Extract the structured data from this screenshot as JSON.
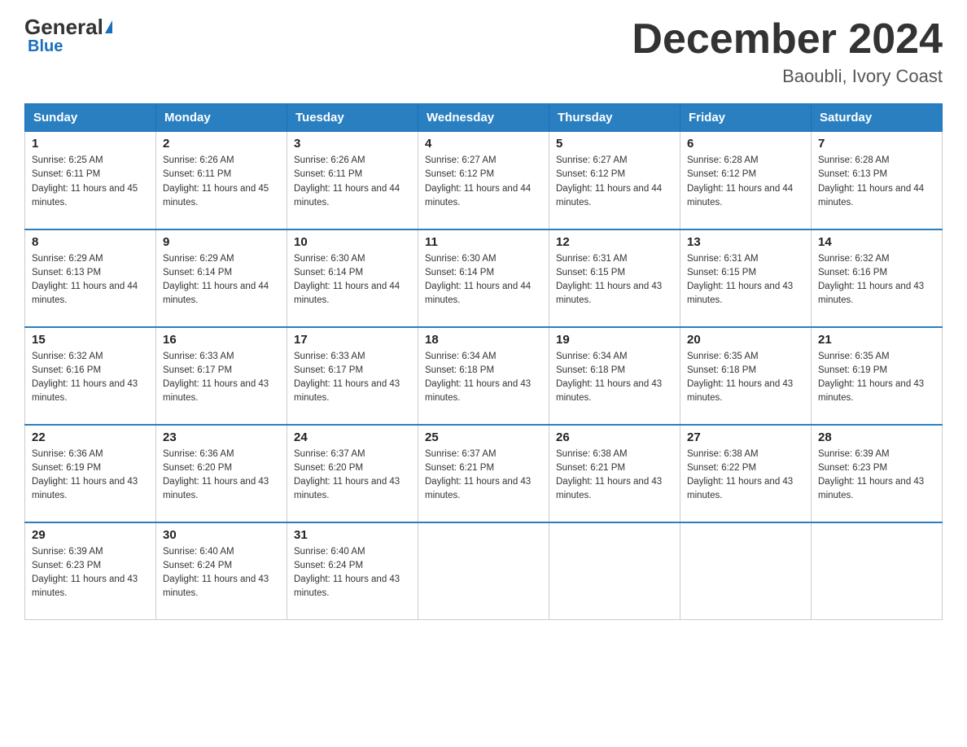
{
  "logo": {
    "general": "General",
    "blue": "Blue"
  },
  "title": "December 2024",
  "subtitle": "Baoubli, Ivory Coast",
  "weekdays": [
    "Sunday",
    "Monday",
    "Tuesday",
    "Wednesday",
    "Thursday",
    "Friday",
    "Saturday"
  ],
  "weeks": [
    [
      {
        "day": "1",
        "sunrise": "Sunrise: 6:25 AM",
        "sunset": "Sunset: 6:11 PM",
        "daylight": "Daylight: 11 hours and 45 minutes."
      },
      {
        "day": "2",
        "sunrise": "Sunrise: 6:26 AM",
        "sunset": "Sunset: 6:11 PM",
        "daylight": "Daylight: 11 hours and 45 minutes."
      },
      {
        "day": "3",
        "sunrise": "Sunrise: 6:26 AM",
        "sunset": "Sunset: 6:11 PM",
        "daylight": "Daylight: 11 hours and 44 minutes."
      },
      {
        "day": "4",
        "sunrise": "Sunrise: 6:27 AM",
        "sunset": "Sunset: 6:12 PM",
        "daylight": "Daylight: 11 hours and 44 minutes."
      },
      {
        "day": "5",
        "sunrise": "Sunrise: 6:27 AM",
        "sunset": "Sunset: 6:12 PM",
        "daylight": "Daylight: 11 hours and 44 minutes."
      },
      {
        "day": "6",
        "sunrise": "Sunrise: 6:28 AM",
        "sunset": "Sunset: 6:12 PM",
        "daylight": "Daylight: 11 hours and 44 minutes."
      },
      {
        "day": "7",
        "sunrise": "Sunrise: 6:28 AM",
        "sunset": "Sunset: 6:13 PM",
        "daylight": "Daylight: 11 hours and 44 minutes."
      }
    ],
    [
      {
        "day": "8",
        "sunrise": "Sunrise: 6:29 AM",
        "sunset": "Sunset: 6:13 PM",
        "daylight": "Daylight: 11 hours and 44 minutes."
      },
      {
        "day": "9",
        "sunrise": "Sunrise: 6:29 AM",
        "sunset": "Sunset: 6:14 PM",
        "daylight": "Daylight: 11 hours and 44 minutes."
      },
      {
        "day": "10",
        "sunrise": "Sunrise: 6:30 AM",
        "sunset": "Sunset: 6:14 PM",
        "daylight": "Daylight: 11 hours and 44 minutes."
      },
      {
        "day": "11",
        "sunrise": "Sunrise: 6:30 AM",
        "sunset": "Sunset: 6:14 PM",
        "daylight": "Daylight: 11 hours and 44 minutes."
      },
      {
        "day": "12",
        "sunrise": "Sunrise: 6:31 AM",
        "sunset": "Sunset: 6:15 PM",
        "daylight": "Daylight: 11 hours and 43 minutes."
      },
      {
        "day": "13",
        "sunrise": "Sunrise: 6:31 AM",
        "sunset": "Sunset: 6:15 PM",
        "daylight": "Daylight: 11 hours and 43 minutes."
      },
      {
        "day": "14",
        "sunrise": "Sunrise: 6:32 AM",
        "sunset": "Sunset: 6:16 PM",
        "daylight": "Daylight: 11 hours and 43 minutes."
      }
    ],
    [
      {
        "day": "15",
        "sunrise": "Sunrise: 6:32 AM",
        "sunset": "Sunset: 6:16 PM",
        "daylight": "Daylight: 11 hours and 43 minutes."
      },
      {
        "day": "16",
        "sunrise": "Sunrise: 6:33 AM",
        "sunset": "Sunset: 6:17 PM",
        "daylight": "Daylight: 11 hours and 43 minutes."
      },
      {
        "day": "17",
        "sunrise": "Sunrise: 6:33 AM",
        "sunset": "Sunset: 6:17 PM",
        "daylight": "Daylight: 11 hours and 43 minutes."
      },
      {
        "day": "18",
        "sunrise": "Sunrise: 6:34 AM",
        "sunset": "Sunset: 6:18 PM",
        "daylight": "Daylight: 11 hours and 43 minutes."
      },
      {
        "day": "19",
        "sunrise": "Sunrise: 6:34 AM",
        "sunset": "Sunset: 6:18 PM",
        "daylight": "Daylight: 11 hours and 43 minutes."
      },
      {
        "day": "20",
        "sunrise": "Sunrise: 6:35 AM",
        "sunset": "Sunset: 6:18 PM",
        "daylight": "Daylight: 11 hours and 43 minutes."
      },
      {
        "day": "21",
        "sunrise": "Sunrise: 6:35 AM",
        "sunset": "Sunset: 6:19 PM",
        "daylight": "Daylight: 11 hours and 43 minutes."
      }
    ],
    [
      {
        "day": "22",
        "sunrise": "Sunrise: 6:36 AM",
        "sunset": "Sunset: 6:19 PM",
        "daylight": "Daylight: 11 hours and 43 minutes."
      },
      {
        "day": "23",
        "sunrise": "Sunrise: 6:36 AM",
        "sunset": "Sunset: 6:20 PM",
        "daylight": "Daylight: 11 hours and 43 minutes."
      },
      {
        "day": "24",
        "sunrise": "Sunrise: 6:37 AM",
        "sunset": "Sunset: 6:20 PM",
        "daylight": "Daylight: 11 hours and 43 minutes."
      },
      {
        "day": "25",
        "sunrise": "Sunrise: 6:37 AM",
        "sunset": "Sunset: 6:21 PM",
        "daylight": "Daylight: 11 hours and 43 minutes."
      },
      {
        "day": "26",
        "sunrise": "Sunrise: 6:38 AM",
        "sunset": "Sunset: 6:21 PM",
        "daylight": "Daylight: 11 hours and 43 minutes."
      },
      {
        "day": "27",
        "sunrise": "Sunrise: 6:38 AM",
        "sunset": "Sunset: 6:22 PM",
        "daylight": "Daylight: 11 hours and 43 minutes."
      },
      {
        "day": "28",
        "sunrise": "Sunrise: 6:39 AM",
        "sunset": "Sunset: 6:23 PM",
        "daylight": "Daylight: 11 hours and 43 minutes."
      }
    ],
    [
      {
        "day": "29",
        "sunrise": "Sunrise: 6:39 AM",
        "sunset": "Sunset: 6:23 PM",
        "daylight": "Daylight: 11 hours and 43 minutes."
      },
      {
        "day": "30",
        "sunrise": "Sunrise: 6:40 AM",
        "sunset": "Sunset: 6:24 PM",
        "daylight": "Daylight: 11 hours and 43 minutes."
      },
      {
        "day": "31",
        "sunrise": "Sunrise: 6:40 AM",
        "sunset": "Sunset: 6:24 PM",
        "daylight": "Daylight: 11 hours and 43 minutes."
      },
      null,
      null,
      null,
      null
    ]
  ]
}
